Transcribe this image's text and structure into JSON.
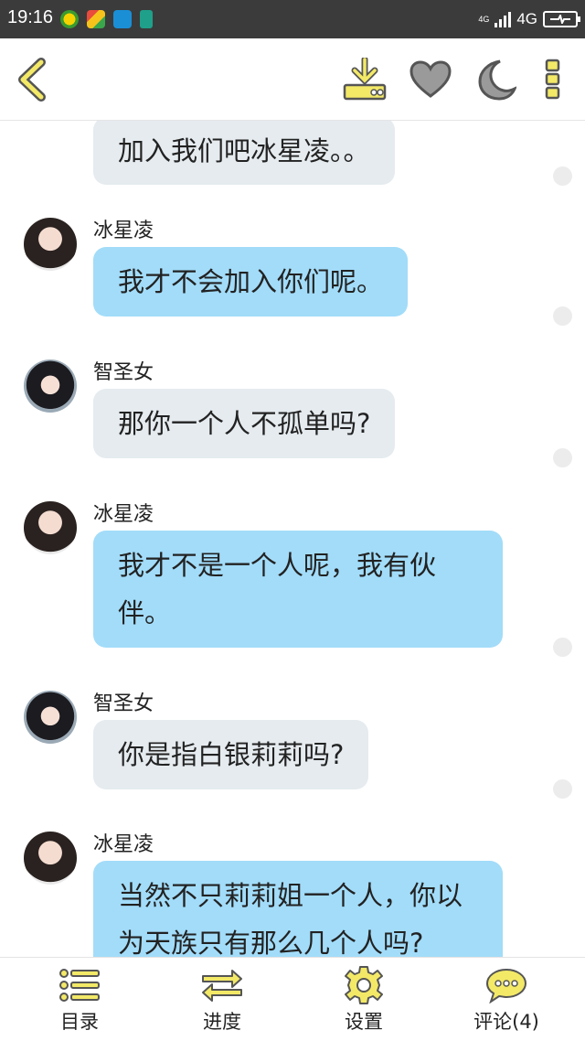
{
  "status_bar": {
    "time": "19:16",
    "network_small": "4G",
    "network": "4G"
  },
  "toolbar": {
    "back_icon": "chevron-left-icon",
    "download_icon": "download-icon",
    "favorite_icon": "heart-icon",
    "night_mode_icon": "moon-icon",
    "more_icon": "more-vertical-icon"
  },
  "messages": [
    {
      "sender": "",
      "text_lines": [
        "加入我们吧冰星凌。。"
      ],
      "style": "gray",
      "avatar": "avatar-f2",
      "partial": true
    },
    {
      "sender": "冰星凌",
      "text_lines": [
        "我才不会加入你们呢。"
      ],
      "style": "blue",
      "avatar": "avatar-f1"
    },
    {
      "sender": "智圣女",
      "text_lines": [
        "那你一个人不孤单吗?"
      ],
      "style": "gray",
      "avatar": "avatar-f2"
    },
    {
      "sender": "冰星凌",
      "text_lines": [
        "我才不是一个人呢，我有伙",
        "伴。"
      ],
      "style": "blue",
      "avatar": "avatar-f1"
    },
    {
      "sender": "智圣女",
      "text_lines": [
        "你是指白银莉莉吗?"
      ],
      "style": "gray",
      "avatar": "avatar-f2"
    },
    {
      "sender": "冰星凌",
      "text_lines": [
        "当然不只莉莉姐一个人，你以",
        "为天族只有那么几个人吗?"
      ],
      "style": "blue",
      "avatar": "avatar-f1"
    }
  ],
  "bottom_nav": [
    {
      "label": "目录",
      "icon": "list-icon"
    },
    {
      "label": "进度",
      "icon": "swap-arrows-icon"
    },
    {
      "label": "设置",
      "icon": "gear-icon"
    },
    {
      "label": "评论(4)",
      "icon": "comment-icon"
    }
  ],
  "colors": {
    "accent_yellow": "#f3e967",
    "accent_outline": "#555555",
    "bubble_gray": "#e5ebef",
    "bubble_blue": "#a2dcf9"
  }
}
